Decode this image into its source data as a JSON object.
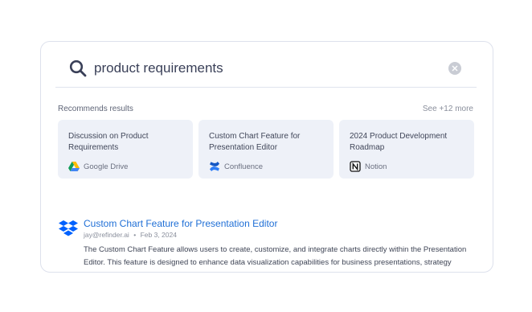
{
  "search": {
    "query": "product requirements"
  },
  "recommendations": {
    "heading": "Recommends results",
    "see_more": "See +12 more",
    "cards": [
      {
        "title": "Discussion on Product Requirements",
        "source": "Google Drive",
        "icon": "google-drive-icon"
      },
      {
        "title": "Custom Chart Feature for Presentation Editor",
        "source": "Confluence",
        "icon": "confluence-icon"
      },
      {
        "title": "2024 Product Development Roadmap",
        "source": "Notion",
        "icon": "notion-icon"
      }
    ]
  },
  "result": {
    "icon": "dropbox-icon",
    "title": "Custom Chart Feature for Presentation Editor",
    "author": "jay@refinder.ai",
    "separator": "•",
    "date": "Feb 3, 2024",
    "snippet": "The Custom Chart Feature allows users to create, customize, and integrate charts directly within the Presentation Editor. This feature is designed to enhance data visualization capabilities for business presentations, strategy"
  },
  "colors": {
    "link": "#1f6fd6",
    "card_bg": "#eef1f8",
    "dropbox": "#0061fe"
  }
}
